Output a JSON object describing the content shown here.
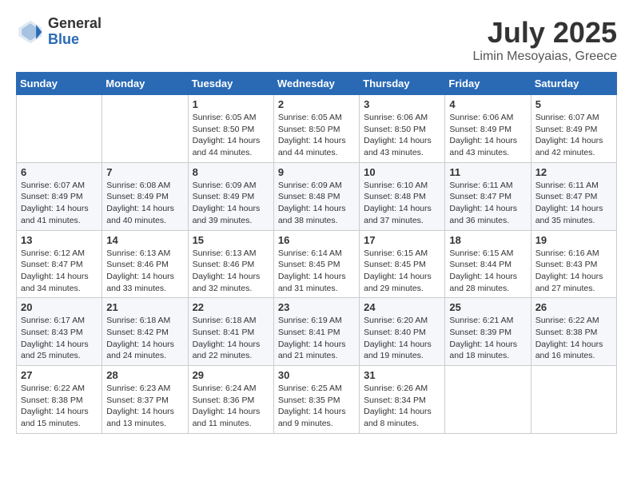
{
  "logo": {
    "general": "General",
    "blue": "Blue"
  },
  "header": {
    "month": "July 2025",
    "location": "Limin Mesoyaias, Greece"
  },
  "weekdays": [
    "Sunday",
    "Monday",
    "Tuesday",
    "Wednesday",
    "Thursday",
    "Friday",
    "Saturday"
  ],
  "weeks": [
    [
      {
        "day": null
      },
      {
        "day": null
      },
      {
        "day": 1,
        "sunrise": "Sunrise: 6:05 AM",
        "sunset": "Sunset: 8:50 PM",
        "daylight": "Daylight: 14 hours and 44 minutes."
      },
      {
        "day": 2,
        "sunrise": "Sunrise: 6:05 AM",
        "sunset": "Sunset: 8:50 PM",
        "daylight": "Daylight: 14 hours and 44 minutes."
      },
      {
        "day": 3,
        "sunrise": "Sunrise: 6:06 AM",
        "sunset": "Sunset: 8:50 PM",
        "daylight": "Daylight: 14 hours and 43 minutes."
      },
      {
        "day": 4,
        "sunrise": "Sunrise: 6:06 AM",
        "sunset": "Sunset: 8:49 PM",
        "daylight": "Daylight: 14 hours and 43 minutes."
      },
      {
        "day": 5,
        "sunrise": "Sunrise: 6:07 AM",
        "sunset": "Sunset: 8:49 PM",
        "daylight": "Daylight: 14 hours and 42 minutes."
      }
    ],
    [
      {
        "day": 6,
        "sunrise": "Sunrise: 6:07 AM",
        "sunset": "Sunset: 8:49 PM",
        "daylight": "Daylight: 14 hours and 41 minutes."
      },
      {
        "day": 7,
        "sunrise": "Sunrise: 6:08 AM",
        "sunset": "Sunset: 8:49 PM",
        "daylight": "Daylight: 14 hours and 40 minutes."
      },
      {
        "day": 8,
        "sunrise": "Sunrise: 6:09 AM",
        "sunset": "Sunset: 8:49 PM",
        "daylight": "Daylight: 14 hours and 39 minutes."
      },
      {
        "day": 9,
        "sunrise": "Sunrise: 6:09 AM",
        "sunset": "Sunset: 8:48 PM",
        "daylight": "Daylight: 14 hours and 38 minutes."
      },
      {
        "day": 10,
        "sunrise": "Sunrise: 6:10 AM",
        "sunset": "Sunset: 8:48 PM",
        "daylight": "Daylight: 14 hours and 37 minutes."
      },
      {
        "day": 11,
        "sunrise": "Sunrise: 6:11 AM",
        "sunset": "Sunset: 8:47 PM",
        "daylight": "Daylight: 14 hours and 36 minutes."
      },
      {
        "day": 12,
        "sunrise": "Sunrise: 6:11 AM",
        "sunset": "Sunset: 8:47 PM",
        "daylight": "Daylight: 14 hours and 35 minutes."
      }
    ],
    [
      {
        "day": 13,
        "sunrise": "Sunrise: 6:12 AM",
        "sunset": "Sunset: 8:47 PM",
        "daylight": "Daylight: 14 hours and 34 minutes."
      },
      {
        "day": 14,
        "sunrise": "Sunrise: 6:13 AM",
        "sunset": "Sunset: 8:46 PM",
        "daylight": "Daylight: 14 hours and 33 minutes."
      },
      {
        "day": 15,
        "sunrise": "Sunrise: 6:13 AM",
        "sunset": "Sunset: 8:46 PM",
        "daylight": "Daylight: 14 hours and 32 minutes."
      },
      {
        "day": 16,
        "sunrise": "Sunrise: 6:14 AM",
        "sunset": "Sunset: 8:45 PM",
        "daylight": "Daylight: 14 hours and 31 minutes."
      },
      {
        "day": 17,
        "sunrise": "Sunrise: 6:15 AM",
        "sunset": "Sunset: 8:45 PM",
        "daylight": "Daylight: 14 hours and 29 minutes."
      },
      {
        "day": 18,
        "sunrise": "Sunrise: 6:15 AM",
        "sunset": "Sunset: 8:44 PM",
        "daylight": "Daylight: 14 hours and 28 minutes."
      },
      {
        "day": 19,
        "sunrise": "Sunrise: 6:16 AM",
        "sunset": "Sunset: 8:43 PM",
        "daylight": "Daylight: 14 hours and 27 minutes."
      }
    ],
    [
      {
        "day": 20,
        "sunrise": "Sunrise: 6:17 AM",
        "sunset": "Sunset: 8:43 PM",
        "daylight": "Daylight: 14 hours and 25 minutes."
      },
      {
        "day": 21,
        "sunrise": "Sunrise: 6:18 AM",
        "sunset": "Sunset: 8:42 PM",
        "daylight": "Daylight: 14 hours and 24 minutes."
      },
      {
        "day": 22,
        "sunrise": "Sunrise: 6:18 AM",
        "sunset": "Sunset: 8:41 PM",
        "daylight": "Daylight: 14 hours and 22 minutes."
      },
      {
        "day": 23,
        "sunrise": "Sunrise: 6:19 AM",
        "sunset": "Sunset: 8:41 PM",
        "daylight": "Daylight: 14 hours and 21 minutes."
      },
      {
        "day": 24,
        "sunrise": "Sunrise: 6:20 AM",
        "sunset": "Sunset: 8:40 PM",
        "daylight": "Daylight: 14 hours and 19 minutes."
      },
      {
        "day": 25,
        "sunrise": "Sunrise: 6:21 AM",
        "sunset": "Sunset: 8:39 PM",
        "daylight": "Daylight: 14 hours and 18 minutes."
      },
      {
        "day": 26,
        "sunrise": "Sunrise: 6:22 AM",
        "sunset": "Sunset: 8:38 PM",
        "daylight": "Daylight: 14 hours and 16 minutes."
      }
    ],
    [
      {
        "day": 27,
        "sunrise": "Sunrise: 6:22 AM",
        "sunset": "Sunset: 8:38 PM",
        "daylight": "Daylight: 14 hours and 15 minutes."
      },
      {
        "day": 28,
        "sunrise": "Sunrise: 6:23 AM",
        "sunset": "Sunset: 8:37 PM",
        "daylight": "Daylight: 14 hours and 13 minutes."
      },
      {
        "day": 29,
        "sunrise": "Sunrise: 6:24 AM",
        "sunset": "Sunset: 8:36 PM",
        "daylight": "Daylight: 14 hours and 11 minutes."
      },
      {
        "day": 30,
        "sunrise": "Sunrise: 6:25 AM",
        "sunset": "Sunset: 8:35 PM",
        "daylight": "Daylight: 14 hours and 9 minutes."
      },
      {
        "day": 31,
        "sunrise": "Sunrise: 6:26 AM",
        "sunset": "Sunset: 8:34 PM",
        "daylight": "Daylight: 14 hours and 8 minutes."
      },
      {
        "day": null
      },
      {
        "day": null
      }
    ]
  ]
}
